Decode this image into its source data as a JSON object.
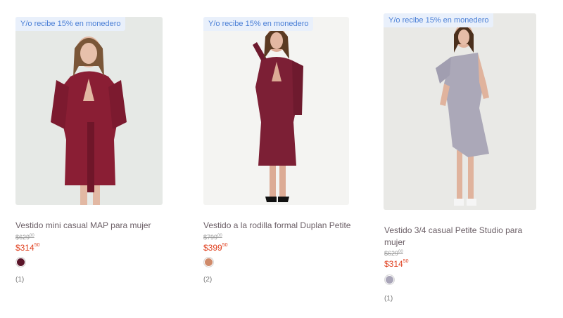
{
  "products": [
    {
      "promo": "Y/o recibe 15% en monedero",
      "title": "Vestido mini casual MAP para mujer",
      "old_price": "$629",
      "old_price_cents": "00",
      "price": "$314",
      "price_cents": "50",
      "swatch_color": "#5a1428",
      "reviews": "(1)"
    },
    {
      "promo": "Y/o recibe 15% en monedero",
      "title": "Vestido a la rodilla formal Duplan Petite",
      "old_price": "$799",
      "old_price_cents": "00",
      "price": "$399",
      "price_cents": "50",
      "swatch_color": "#cf8a6a",
      "reviews": "(2)"
    },
    {
      "promo": "Y/o recibe 15% en monedero",
      "title": "Vestido 3/4 casual Petite Studio para mujer",
      "old_price": "$629",
      "old_price_cents": "00",
      "price": "$314",
      "price_cents": "50",
      "swatch_color": "#a9a5b8",
      "reviews": "(1)"
    }
  ],
  "colors": {
    "promo_bg": "#e9f0fb",
    "promo_text": "#4a7fd6",
    "price": "#e0401f"
  }
}
